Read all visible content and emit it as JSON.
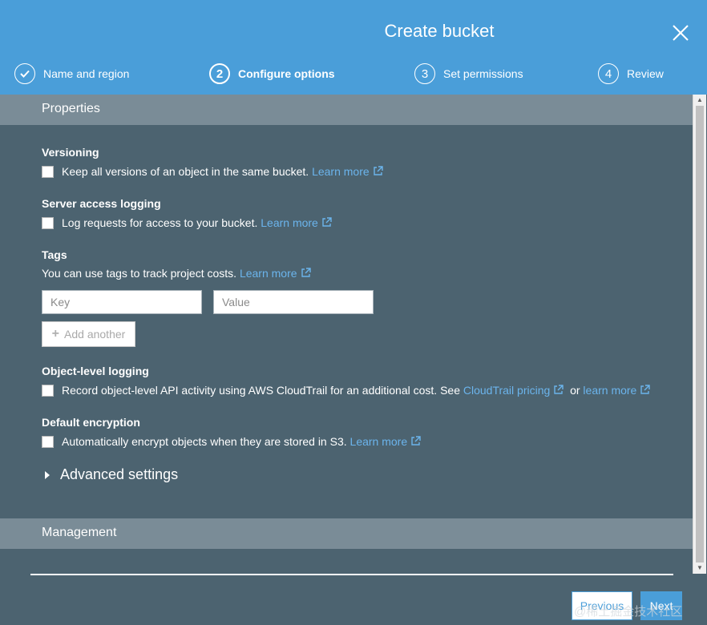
{
  "dialog": {
    "title": "Create bucket"
  },
  "steps": [
    {
      "number": "",
      "label": "Name and region",
      "state": "done"
    },
    {
      "number": "2",
      "label": "Configure options",
      "state": "active"
    },
    {
      "number": "3",
      "label": "Set permissions",
      "state": "pending"
    },
    {
      "number": "4",
      "label": "Review",
      "state": "pending"
    }
  ],
  "properties": {
    "heading": "Properties",
    "versioning": {
      "title": "Versioning",
      "text": "Keep all versions of an object in the same bucket.",
      "link": "Learn more",
      "checked": false
    },
    "server_access_logging": {
      "title": "Server access logging",
      "text": "Log requests for access to your bucket.",
      "link": "Learn more",
      "checked": false
    },
    "tags": {
      "title": "Tags",
      "text": "You can use tags to track project costs.",
      "link": "Learn more",
      "key_placeholder": "Key",
      "value_placeholder": "Value",
      "add_label": "Add another"
    },
    "object_level_logging": {
      "title": "Object-level logging",
      "text": "Record object-level API activity using AWS CloudTrail for an additional cost. See",
      "link1": "CloudTrail pricing",
      "middle": "or",
      "link2": "learn more",
      "checked": false
    },
    "default_encryption": {
      "title": "Default encryption",
      "text": "Automatically encrypt objects when they are stored in S3.",
      "link": "Learn more",
      "checked": false
    },
    "advanced_settings": "Advanced settings"
  },
  "management": {
    "heading": "Management"
  },
  "footer": {
    "previous": "Previous",
    "next": "Next",
    "watermark": "@稀土掘金技术社区"
  },
  "colors": {
    "header": "#4a9ed9",
    "panel": "#4c6370",
    "section_header": "#7a8c97",
    "link": "#6bb4ec"
  }
}
